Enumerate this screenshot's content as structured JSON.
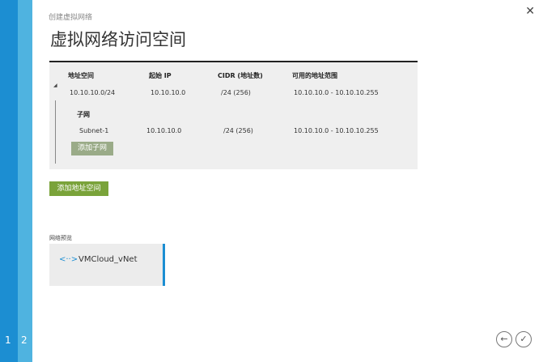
{
  "wizard": {
    "steps": [
      "1",
      "2"
    ],
    "close_icon": "✕"
  },
  "header": {
    "breadcrumb": "创建虚拟网络",
    "title": "虚拟网络访问空间"
  },
  "table": {
    "columns": [
      "地址空间",
      "起始 IP",
      "CIDR (地址数)",
      "可用的地址范围"
    ],
    "address_space": {
      "address": "10.10.10.0/24",
      "start_ip": "10.10.10.0",
      "cidr": "/24 (256)",
      "range": "10.10.10.0 - 10.10.10.255"
    },
    "subnet_section_label": "子网",
    "subnets": [
      {
        "name": "Subnet-1",
        "start_ip": "10.10.10.0",
        "cidr": "/24 (256)",
        "range": "10.10.10.0 - 10.10.10.255"
      }
    ],
    "add_subnet_label": "添加子网"
  },
  "add_address_space_label": "添加地址空间",
  "network_preview": {
    "label": "网络预览",
    "network_name": "VMCloud_vNet",
    "icon": "<··>"
  },
  "navigation": {
    "back_icon": "←",
    "finish_icon": "✓"
  },
  "colors": {
    "rail": "#1c8ed2",
    "accent_green": "#7aa33a",
    "subnet_button": "#9aab88"
  }
}
